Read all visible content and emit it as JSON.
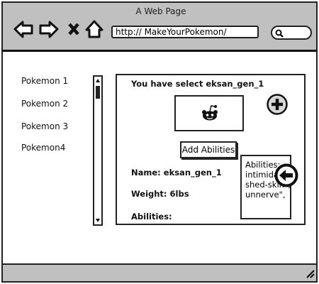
{
  "browser": {
    "title": "A Web Page",
    "url": "http:// MakeYourPokemon/"
  },
  "sidebar": {
    "items": [
      {
        "label": "Pokemon 1"
      },
      {
        "label": "Pokemon 2"
      },
      {
        "label": "Pokemon 3"
      },
      {
        "label": "Pokemon4"
      }
    ]
  },
  "panel": {
    "heading": "You have select eksan_gen_1",
    "image_icon": "reddit-alien-icon",
    "add_abilities_label": "Add Abilities",
    "name": "Name: eksan_gen_1",
    "weight": "Weight: 6lbs",
    "abilities_label": "Abilities:",
    "tooltip_lines": [
      "Abilities:",
      "intimidate",
      "shed-skin\",",
      "unnerve\","
    ]
  }
}
